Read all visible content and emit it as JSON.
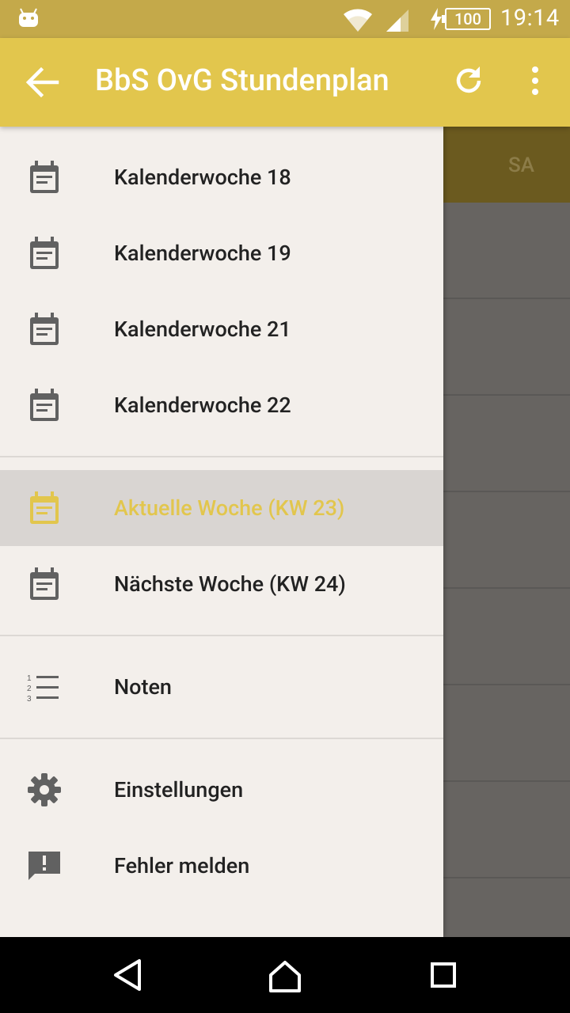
{
  "status_bar": {
    "battery": "100",
    "time": "19:14"
  },
  "app_bar": {
    "title": "BbS OvG Stundenplan"
  },
  "background": {
    "day_header": "SA"
  },
  "drawer": {
    "weeks": [
      {
        "label": "Kalenderwoche 18",
        "icon": "calendar-icon"
      },
      {
        "label": "Kalenderwoche 19",
        "icon": "calendar-icon"
      },
      {
        "label": "Kalenderwoche 21",
        "icon": "calendar-icon"
      },
      {
        "label": "Kalenderwoche 22",
        "icon": "calendar-icon"
      }
    ],
    "current_week": {
      "label": "Aktuelle Woche (KW 23)",
      "icon": "calendar-icon",
      "active": true
    },
    "next_week": {
      "label": "Nächste Woche (KW 24)",
      "icon": "calendar-icon"
    },
    "grades": {
      "label": "Noten",
      "icon": "numbered-list-icon"
    },
    "settings": {
      "label": "Einstellungen",
      "icon": "gear-icon"
    },
    "report": {
      "label": "Fehler melden",
      "icon": "feedback-icon"
    }
  },
  "colors": {
    "primary": "#e2c64d",
    "status_bar": "#c4a94a",
    "drawer_bg": "#f3efeb",
    "active_bg": "#d9d5d2",
    "icon": "#616161"
  }
}
